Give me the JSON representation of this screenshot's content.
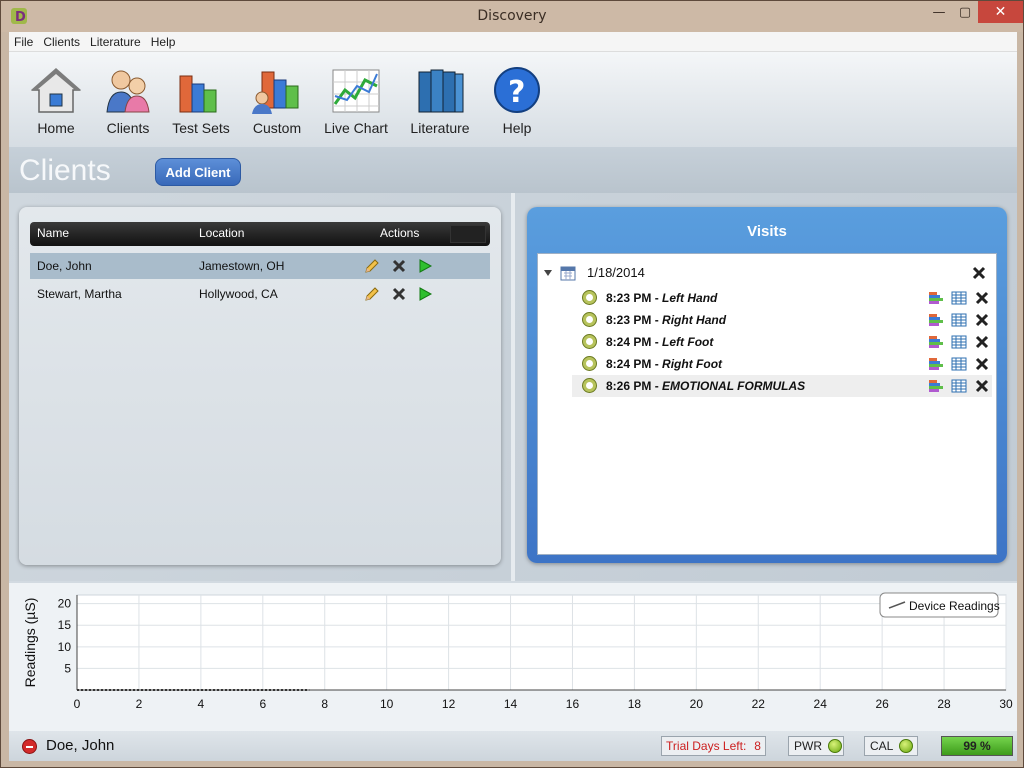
{
  "window": {
    "title": "Discovery"
  },
  "menu": [
    "File",
    "Clients",
    "Literature",
    "Help"
  ],
  "toolbar": {
    "home": "Home",
    "clients": "Clients",
    "test_sets": "Test Sets",
    "custom": "Custom",
    "live_chart": "Live Chart",
    "literature": "Literature",
    "help": "Help"
  },
  "page": {
    "title": "Clients",
    "add_client": "Add Client"
  },
  "clients_table": {
    "columns": {
      "name": "Name",
      "location": "Location",
      "actions": "Actions"
    },
    "rows": [
      {
        "name": "Doe, John",
        "location": "Jamestown, OH",
        "selected": true
      },
      {
        "name": "Stewart, Martha",
        "location": "Hollywood, CA",
        "selected": false
      }
    ]
  },
  "visits": {
    "title": "Visits",
    "date": "1/18/2014",
    "entries": [
      {
        "time": "8:23 PM",
        "sep": "-",
        "name": "Left Hand"
      },
      {
        "time": "8:23 PM",
        "sep": "-",
        "name": "Right Hand"
      },
      {
        "time": "8:24 PM",
        "sep": "-",
        "name": "Left Foot"
      },
      {
        "time": "8:24 PM",
        "sep": "-",
        "name": "Right Foot"
      },
      {
        "time": "8:26 PM",
        "sep": "-",
        "name": "EMOTIONAL FORMULAS"
      }
    ]
  },
  "chart_data": {
    "type": "line",
    "ylabel": "Readings (µS)",
    "xlabel": "",
    "x_ticks": [
      0,
      2,
      4,
      6,
      8,
      10,
      12,
      14,
      16,
      18,
      20,
      22,
      24,
      26,
      28,
      30
    ],
    "y_ticks": [
      5,
      10,
      15,
      20
    ],
    "xlim": [
      0,
      30
    ],
    "ylim": [
      0,
      22
    ],
    "legend": "top-right",
    "grid": true,
    "series": [
      {
        "name": "Device Readings",
        "x": [
          0,
          7.5
        ],
        "y": [
          0,
          0
        ]
      }
    ]
  },
  "status": {
    "client": "Doe, John",
    "trial_label": "Trial Days Left:",
    "trial_days": "8",
    "pwr": "PWR",
    "cal": "CAL",
    "battery": "99 %"
  },
  "colors": {
    "accent": "#3d74c6",
    "selected_row": "#a9bccb",
    "trial_text": "#cc2020",
    "led": "#6aa80f"
  }
}
